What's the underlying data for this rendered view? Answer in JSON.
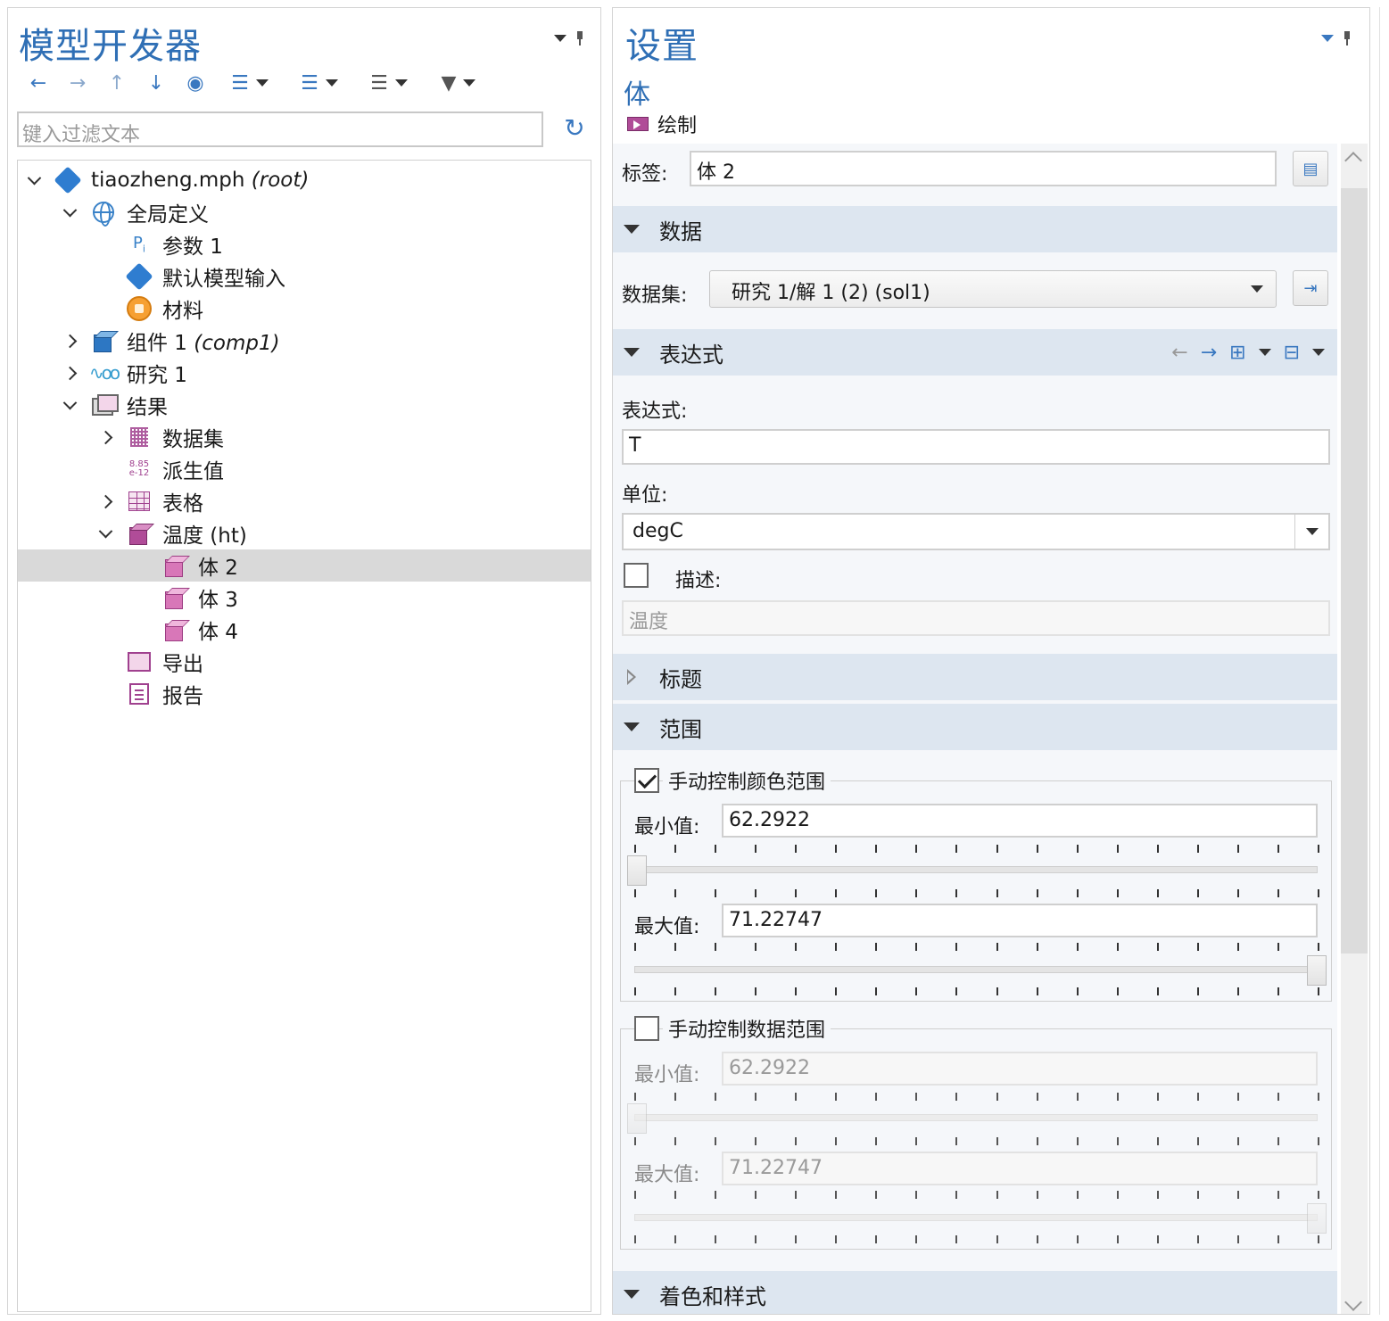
{
  "model_builder": {
    "title": "模型开发器",
    "filter_placeholder": "键入过滤文本",
    "toolbar": {
      "icons": [
        "arrow-left-icon",
        "arrow-right-icon",
        "arrow-up-icon",
        "arrow-down-icon",
        "eye-icon",
        "expand-sections-icon",
        "collapse-sections-icon",
        "list-view-icon",
        "filter-icon"
      ]
    },
    "tree": [
      {
        "label": "tiaozheng.mph",
        "tag": "(root)",
        "level": 0,
        "expand": "down",
        "icon": "file-diamond-icon"
      },
      {
        "label": "全局定义",
        "tag": "",
        "level": 1,
        "expand": "down",
        "icon": "globe-icon"
      },
      {
        "label": "参数 1",
        "tag": "",
        "level": 2,
        "expand": "",
        "icon": "parameters-icon"
      },
      {
        "label": "默认模型输入",
        "tag": "",
        "level": 2,
        "expand": "",
        "icon": "model-inputs-icon"
      },
      {
        "label": "材料",
        "tag": "",
        "level": 2,
        "expand": "",
        "icon": "materials-icon"
      },
      {
        "label": "组件 1",
        "tag": "(comp1)",
        "level": 1,
        "expand": "right",
        "icon": "component-icon"
      },
      {
        "label": "研究 1",
        "tag": "",
        "level": 1,
        "expand": "right",
        "icon": "study-icon"
      },
      {
        "label": "结果",
        "tag": "",
        "level": 1,
        "expand": "down",
        "icon": "results-icon"
      },
      {
        "label": "数据集",
        "tag": "",
        "level": 2,
        "expand": "right",
        "icon": "datasets-icon"
      },
      {
        "label": "派生值",
        "tag": "",
        "level": 2,
        "expand": "",
        "icon": "derived-values-icon"
      },
      {
        "label": "表格",
        "tag": "",
        "level": 2,
        "expand": "right",
        "icon": "tables-icon"
      },
      {
        "label": "温度 (ht)",
        "tag": "",
        "level": 2,
        "expand": "down",
        "icon": "plot-group-3d-icon"
      },
      {
        "label": "体 2",
        "tag": "",
        "level": 3,
        "expand": "",
        "icon": "volume-plot-icon",
        "selected": true
      },
      {
        "label": "体 3",
        "tag": "",
        "level": 3,
        "expand": "",
        "icon": "volume-plot-icon"
      },
      {
        "label": "体 4",
        "tag": "",
        "level": 3,
        "expand": "",
        "icon": "volume-plot-icon"
      },
      {
        "label": "导出",
        "tag": "",
        "level": 2,
        "expand": "",
        "icon": "export-icon"
      },
      {
        "label": "报告",
        "tag": "",
        "level": 2,
        "expand": "",
        "icon": "reports-icon"
      }
    ]
  },
  "settings": {
    "title": "设置",
    "subtitle": "体",
    "plot_label": "绘制",
    "label_field": {
      "label": "标签:",
      "value": "体 2"
    },
    "sections": {
      "data": "数据",
      "expression": "表达式",
      "title": "标题",
      "range": "范围",
      "coloring": "着色和样式"
    },
    "dataset": {
      "label": "数据集:",
      "value": "研究 1/解 1 (2) (sol1)"
    },
    "expression": {
      "label": "表达式:",
      "value": "T"
    },
    "unit": {
      "label": "单位:",
      "value": "degC"
    },
    "description": {
      "label": "描述:",
      "value": "温度",
      "checked": false
    },
    "color_range": {
      "title": "手动控制颜色范围",
      "checked": true,
      "min_label": "最小值:",
      "min_value": "62.2922",
      "max_label": "最大值:",
      "max_value": "71.22747",
      "min_slider_fraction": 0.0,
      "max_slider_fraction": 1.0
    },
    "data_range": {
      "title": "手动控制数据范围",
      "checked": false,
      "min_label": "最小值:",
      "min_value": "62.2922",
      "max_label": "最大值:",
      "max_value": "71.22747",
      "min_slider_fraction": 0.0,
      "max_slider_fraction": 1.0
    }
  }
}
